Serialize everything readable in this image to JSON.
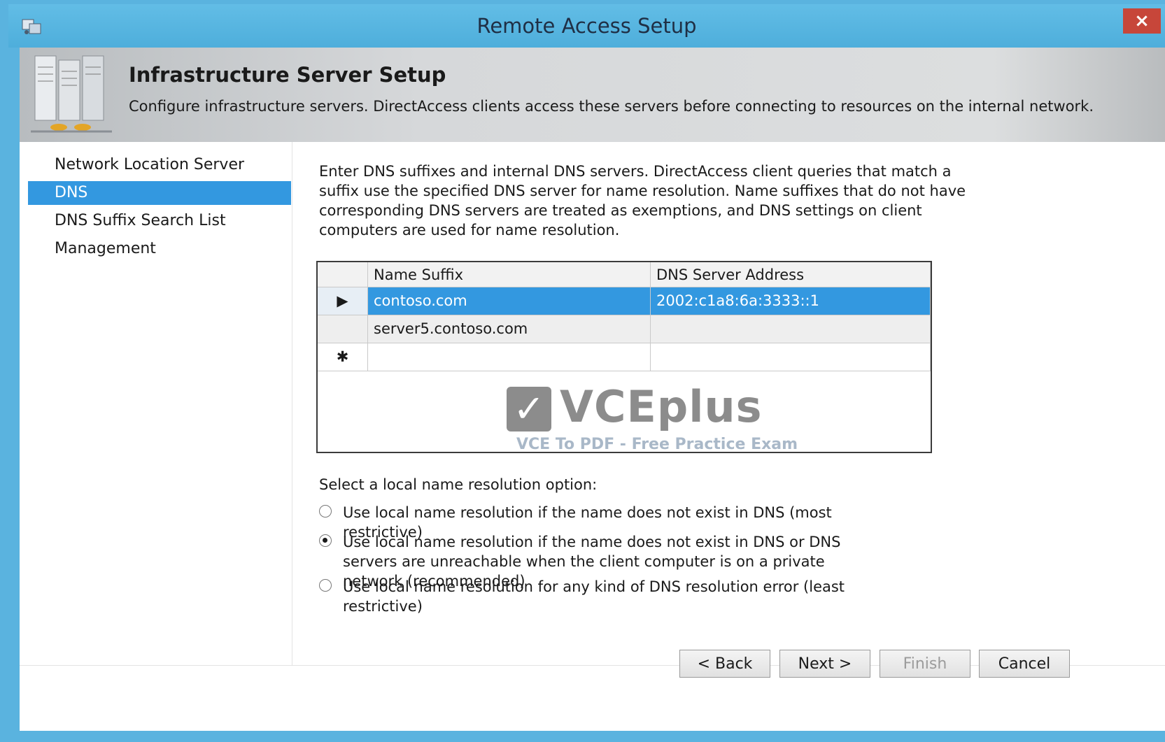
{
  "window": {
    "title": "Remote Access Setup",
    "close_label": "×"
  },
  "header": {
    "title": "Infrastructure Server Setup",
    "description": "Configure infrastructure servers. DirectAccess clients access these servers before connecting to resources on the internal network."
  },
  "nav": {
    "items": [
      {
        "label": "Network Location Server",
        "selected": false
      },
      {
        "label": "DNS",
        "selected": true
      },
      {
        "label": "DNS Suffix Search List",
        "selected": false
      },
      {
        "label": "Management",
        "selected": false
      }
    ]
  },
  "main": {
    "description": "Enter DNS suffixes and internal DNS servers. DirectAccess client queries that match a suffix use the specified DNS server for name resolution. Name suffixes that do not have corresponding DNS servers are treated as exemptions, and DNS settings on client computers are used for name resolution.",
    "grid": {
      "columns": [
        "Name Suffix",
        "DNS Server Address"
      ],
      "rows": [
        {
          "marker": "▶",
          "suffix": "contoso.com",
          "address": "2002:c1a8:6a:3333::1",
          "selected": true
        },
        {
          "marker": "",
          "suffix": "server5.contoso.com",
          "address": "",
          "selected": false
        },
        {
          "marker": "✱",
          "suffix": "",
          "address": "",
          "selected": false
        }
      ]
    },
    "watermark": {
      "check": "✓",
      "brand": "VCEplus",
      "tagline": "VCE To PDF - Free Practice Exam"
    },
    "resolution_label": "Select a local name resolution option:",
    "options": [
      {
        "label": "Use local name resolution if the name does not exist in DNS (most restrictive)",
        "checked": false
      },
      {
        "label": "Use local name resolution if the name does not exist in DNS or DNS servers are unreachable when the client computer is on a private network (recommended)",
        "checked": true
      },
      {
        "label": "Use local name resolution for any kind of DNS resolution error (least restrictive)",
        "checked": false
      }
    ]
  },
  "buttons": {
    "back": "< Back",
    "next": "Next >",
    "finish": "Finish",
    "cancel": "Cancel"
  },
  "colors": {
    "titlebar": "#5ab3df",
    "selection": "#3398e0",
    "close": "#c7463a"
  }
}
